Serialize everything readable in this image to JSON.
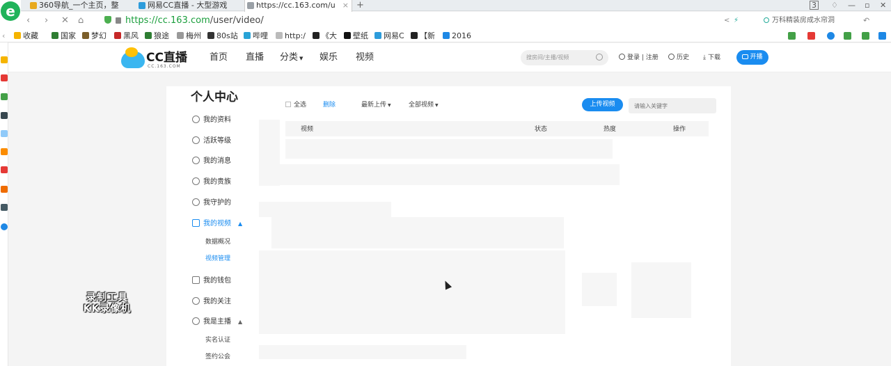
{
  "browser": {
    "tabs": [
      {
        "label": "360导航_一个主页，整",
        "icon_color": "#e8a91e"
      },
      {
        "label": "网易CC直播 - 大型游戏",
        "icon_color": "#2d9cdb"
      },
      {
        "label": "https://cc.163.com/u",
        "icon_color": "#9aa0a6"
      }
    ],
    "tab_count": "3",
    "url_prefix": "https://",
    "url_host": "cc.163.com",
    "url_path": "/user/video/",
    "search_placeholder": "万科精装房成水帘洞",
    "bookmarks": [
      {
        "label": "收藏",
        "icon_color": "#f5b400"
      },
      {
        "label": "国家",
        "icon_color": "#2e7d32"
      },
      {
        "label": "梦幻",
        "icon_color": "#7b5e2a"
      },
      {
        "label": "黑风",
        "icon_color": "#c62828"
      },
      {
        "label": "狼途",
        "icon_color": "#2e7d32"
      },
      {
        "label": "梅州",
        "icon_color": "#999999"
      },
      {
        "label": "80s站",
        "icon_color": "#333333"
      },
      {
        "label": "哔哩",
        "icon_color": "#29a3d6"
      },
      {
        "label": "http:/",
        "icon_color": "#bbbbbb"
      },
      {
        "label": "《大",
        "icon_color": "#222222"
      },
      {
        "label": "壁纸",
        "icon_color": "#111111"
      },
      {
        "label": "网易C",
        "icon_color": "#2d9cdb"
      },
      {
        "label": "【新",
        "icon_color": "#222222"
      },
      {
        "label": "2016",
        "icon_color": "#1e88e5"
      }
    ]
  },
  "site": {
    "logo_text": "CC直播",
    "logo_sub": "CC.163.COM",
    "nav": [
      {
        "label": "首页"
      },
      {
        "label": "直播"
      },
      {
        "label": "分类"
      },
      {
        "label": "娱乐"
      },
      {
        "label": "视频"
      }
    ],
    "search_placeholder": "搜房间/主播/视频",
    "login": "登录",
    "register": "注册",
    "history": "历史",
    "download": "下载",
    "live": "开播"
  },
  "sidebar": {
    "title": "个人中心",
    "items": [
      {
        "label": "我的资料"
      },
      {
        "label": "活跃等级"
      },
      {
        "label": "我的消息"
      },
      {
        "label": "我的贵族"
      },
      {
        "label": "我守护的"
      },
      {
        "label": "我的视频"
      },
      {
        "label": "我的钱包"
      },
      {
        "label": "我的关注"
      },
      {
        "label": "我是主播"
      }
    ],
    "video_sub": [
      {
        "label": "数据概况"
      },
      {
        "label": "视频管理"
      }
    ],
    "anchor_sub": [
      {
        "label": "实名认证"
      },
      {
        "label": "签约公会"
      }
    ]
  },
  "toolbar": {
    "select_all": "全选",
    "delete": "删除",
    "sort": "最新上传",
    "filter": "全部视频",
    "upload": "上传视频",
    "keyword_placeholder": "请输入关键字"
  },
  "table": {
    "headers": [
      "视频",
      "状态",
      "热度",
      "操作"
    ]
  },
  "watermark": {
    "line1": "录制工具",
    "line2": "KK录像机"
  }
}
